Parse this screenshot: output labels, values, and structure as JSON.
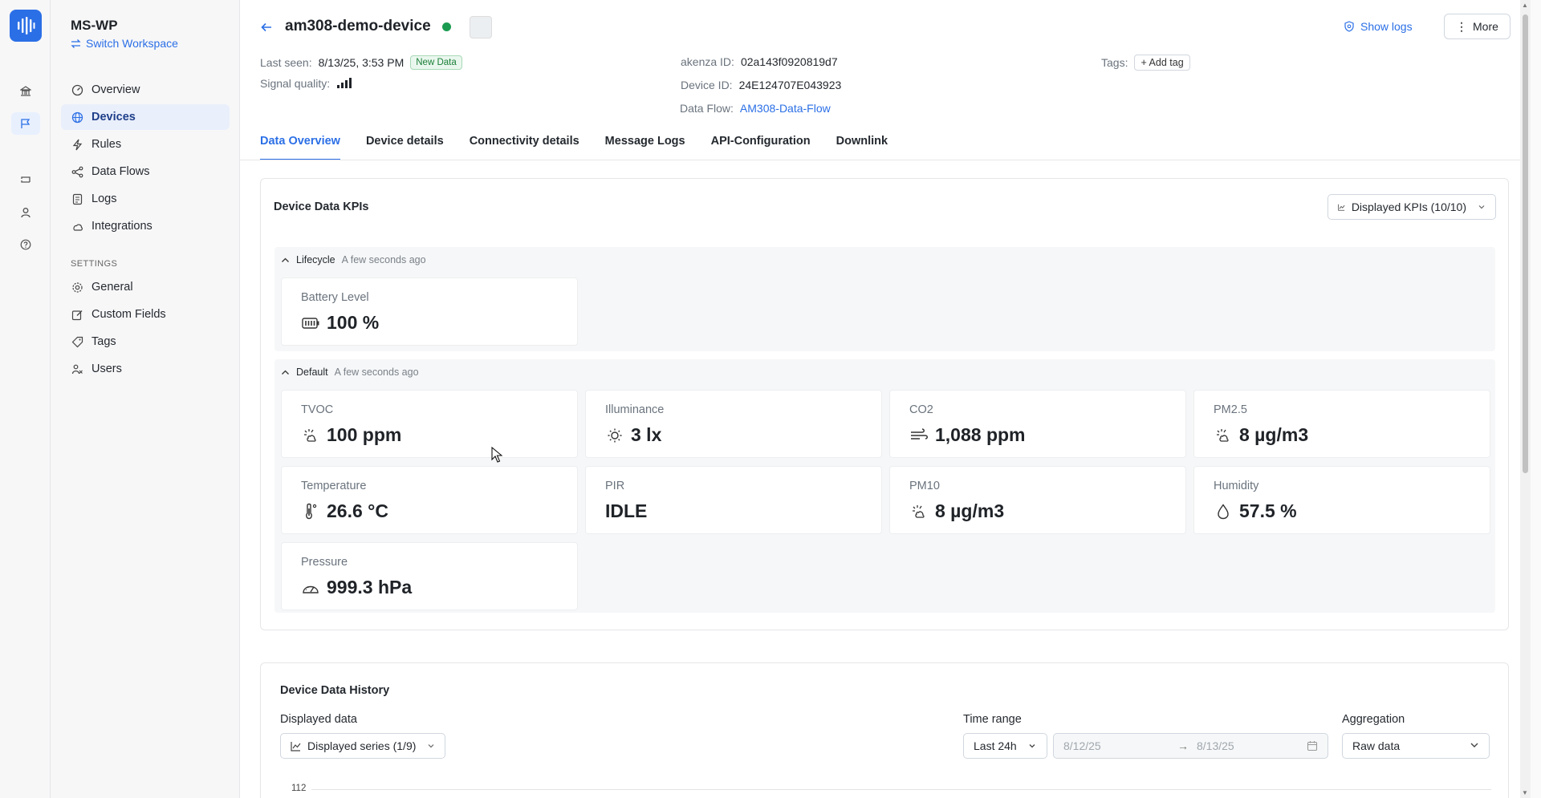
{
  "workspace": {
    "name": "MS-WP",
    "switch_label": "Switch Workspace"
  },
  "nav": {
    "items": [
      {
        "label": "Overview"
      },
      {
        "label": "Devices"
      },
      {
        "label": "Rules"
      },
      {
        "label": "Data Flows"
      },
      {
        "label": "Logs"
      },
      {
        "label": "Integrations"
      }
    ],
    "settings_label": "SETTINGS",
    "settings_items": [
      {
        "label": "General"
      },
      {
        "label": "Custom Fields"
      },
      {
        "label": "Tags"
      },
      {
        "label": "Users"
      }
    ]
  },
  "device": {
    "name": "am308-demo-device",
    "status": "online",
    "last_seen_label": "Last seen:",
    "last_seen": "8/13/25, 3:53 PM",
    "new_data_badge": "New Data",
    "signal_label": "Signal quality:",
    "signal_bars": 4,
    "akenza_id_label": "akenza ID:",
    "akenza_id": "02a143f0920819d7",
    "device_id_label": "Device ID:",
    "device_id": "24E124707E043923",
    "data_flow_label": "Data Flow:",
    "data_flow": "AM308-Data-Flow",
    "tags_label": "Tags:",
    "add_tag": "+ Add tag"
  },
  "header": {
    "show_logs": "Show logs",
    "more": "More"
  },
  "tabs": [
    {
      "label": "Data Overview",
      "active": true
    },
    {
      "label": "Device details"
    },
    {
      "label": "Connectivity details"
    },
    {
      "label": "Message Logs"
    },
    {
      "label": "API-Configuration"
    },
    {
      "label": "Downlink"
    }
  ],
  "kpis": {
    "title": "Device Data KPIs",
    "displayed_kpis": "Displayed KPIs (10/10)",
    "groups": [
      {
        "name": "Lifecycle",
        "ago": "A few seconds ago",
        "items": [
          {
            "label": "Battery Level",
            "value": "100 %",
            "icon": "battery-icon"
          }
        ]
      },
      {
        "name": "Default",
        "ago": "A few seconds ago",
        "items": [
          {
            "label": "TVOC",
            "value": "100 ppm",
            "icon": "air-quality-icon"
          },
          {
            "label": "Illuminance",
            "value": "3 lx",
            "icon": "sun-icon"
          },
          {
            "label": "CO2",
            "value": "1,088 ppm",
            "icon": "wind-icon"
          },
          {
            "label": "PM2.5",
            "value": "8 µg/m3",
            "icon": "air-quality-icon"
          },
          {
            "label": "Temperature",
            "value": "26.6 °C",
            "icon": "thermometer-icon"
          },
          {
            "label": "PIR",
            "value": "IDLE",
            "icon": ""
          },
          {
            "label": "PM10",
            "value": "8 µg/m3",
            "icon": "air-quality-icon"
          },
          {
            "label": "Humidity",
            "value": "57.5 %",
            "icon": "droplet-icon"
          },
          {
            "label": "Pressure",
            "value": "999.3 hPa",
            "icon": "gauge-icon"
          }
        ]
      }
    ]
  },
  "history": {
    "title": "Device Data History",
    "displayed_data_label": "Displayed data",
    "displayed_series": "Displayed series (1/9)",
    "time_range_label": "Time range",
    "time_range": "Last 24h",
    "date_from": "8/12/25",
    "date_arrow": "→",
    "date_to": "8/13/25",
    "aggregation_label": "Aggregation",
    "aggregation": "Raw data",
    "y_top_tick": "112"
  },
  "colors": {
    "accent": "#2b6fe6",
    "online": "#1a9b50"
  }
}
